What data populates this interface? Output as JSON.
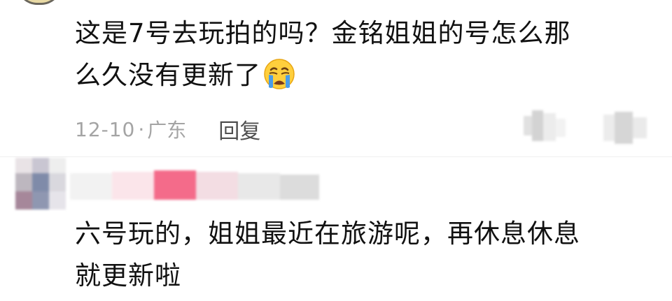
{
  "comment": {
    "text_line_1": "这是7号去玩拍的吗？金铭姐姐的号怎么那",
    "text_line_2": "么久没有更新了",
    "emoji": "crying-face-icon",
    "date": "12-10",
    "separator": "·",
    "location": "广东",
    "reply_label": "回复"
  },
  "reply": {
    "text_line_1": "六号玩的，姐姐最近在旅游呢，再休息休息",
    "text_line_2": "就更新啦"
  },
  "colors": {
    "text": "#111111",
    "meta": "#a4a4a4",
    "reply_button": "#4f4f4f",
    "emoji_face": "#ffcf3d",
    "emoji_tear": "#4a9ce8",
    "username_blur_accent": "#f46b8a"
  }
}
